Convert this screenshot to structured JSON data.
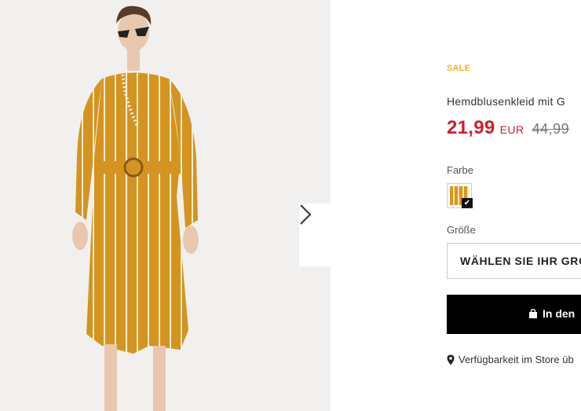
{
  "gallery": {
    "image_alt": "Model in yellow striped shirt dress with belt",
    "next_icon": "chevron-right-icon"
  },
  "product": {
    "badge": "SALE",
    "title": "Hemdblusenkleid mit G",
    "price": "21,99",
    "currency": "EUR",
    "old_price": "44,99"
  },
  "color": {
    "label": "Farbe",
    "selected_check": "✔"
  },
  "size": {
    "label": "Größe",
    "placeholder": "WÄHLEN SIE IHR GRÖ"
  },
  "cart": {
    "label": "In den",
    "icon": "bag-icon"
  },
  "store": {
    "text": "Verfügbarkeit im Store üb",
    "icon": "location-pin-icon"
  },
  "colors": {
    "price_red": "#cc1f2d",
    "sale_yellow": "#f0b21c",
    "button_black": "#000000"
  }
}
